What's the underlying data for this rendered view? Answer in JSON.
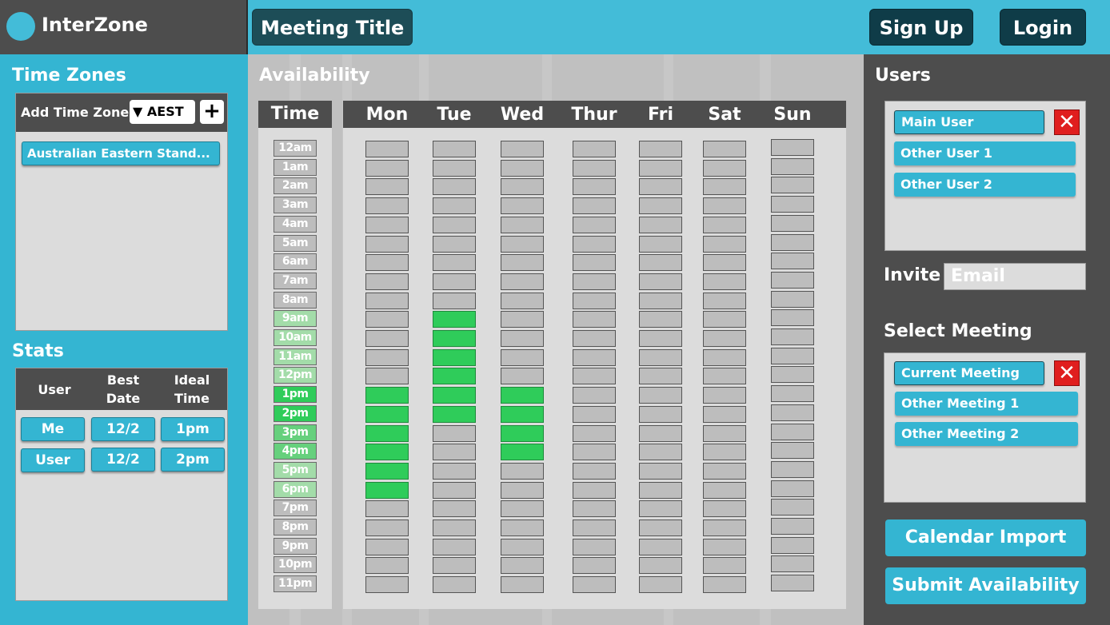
{
  "app": {
    "name": "InterZone"
  },
  "header": {
    "meeting_title": "Meeting Title",
    "signup_label": "Sign Up",
    "login_label": "Login"
  },
  "timezones": {
    "title": "Time Zones",
    "add_label": "Add Time Zone",
    "selected": "▼ AEST",
    "add_button": "+",
    "items": [
      "Australian Eastern Stand..."
    ]
  },
  "stats": {
    "title": "Stats",
    "columns": [
      "User",
      "Best Date",
      "Ideal Time"
    ],
    "rows": [
      {
        "user": "Me",
        "best_date": "12/2",
        "ideal_time": "1pm"
      },
      {
        "user": "User",
        "best_date": "12/2",
        "ideal_time": "2pm"
      }
    ]
  },
  "availability": {
    "title": "Availability",
    "time_header": "Time",
    "days": [
      "Mon",
      "Tue",
      "Wed",
      "Thur",
      "Fri",
      "Sat",
      "Sun"
    ],
    "times": [
      "12am",
      "1am",
      "2am",
      "3am",
      "4am",
      "5am",
      "6am",
      "7am",
      "8am",
      "9am",
      "10am",
      "11am",
      "12pm",
      "1pm",
      "2pm",
      "3pm",
      "4pm",
      "5pm",
      "6pm",
      "7pm",
      "8pm",
      "9pm",
      "10pm",
      "11pm"
    ],
    "time_intensity": [
      0,
      0,
      0,
      0,
      0,
      0,
      0,
      0,
      0,
      1,
      1,
      1,
      1,
      3,
      3,
      2,
      2,
      1,
      1,
      0,
      0,
      0,
      0,
      0
    ],
    "selected": {
      "Mon": [
        "1pm",
        "2pm",
        "3pm",
        "4pm",
        "5pm",
        "6pm"
      ],
      "Tue": [
        "9am",
        "10am",
        "11am",
        "12pm",
        "1pm",
        "2pm"
      ],
      "Wed": [
        "1pm",
        "2pm",
        "3pm",
        "4pm"
      ]
    },
    "colors": {
      "empty": "#bdbdbd",
      "selected": "#2fcc5a",
      "intensity": [
        "#bdbdbd",
        "#a3dca9",
        "#66d07d",
        "#2fcc5a"
      ]
    }
  },
  "users": {
    "title": "Users",
    "items": [
      "Main User",
      "Other User 1",
      "Other User 2"
    ],
    "remove_icon": "✕"
  },
  "invite": {
    "label": "Invite",
    "placeholder": "Email"
  },
  "meetings": {
    "title": "Select Meeting",
    "items": [
      "Current Meeting",
      "Other Meeting 1",
      "Other Meeting 2"
    ],
    "remove_icon": "✕"
  },
  "actions": {
    "calendar_import": "Calendar Import",
    "submit": "Submit Availability"
  }
}
